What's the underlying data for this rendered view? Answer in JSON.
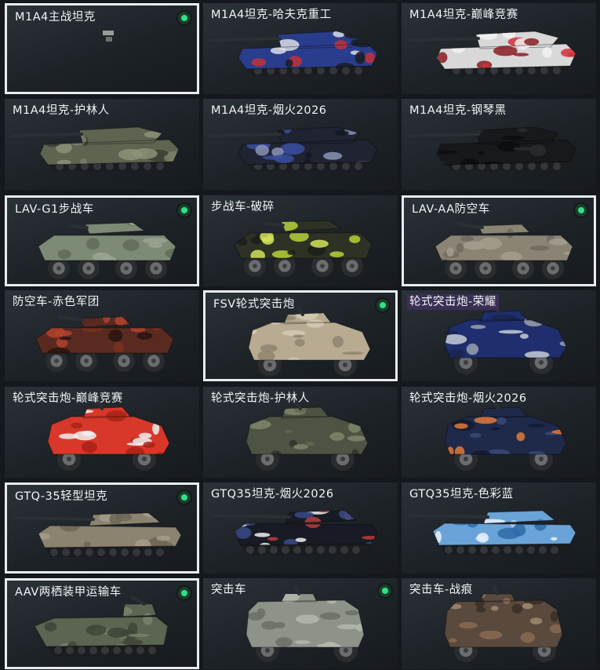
{
  "cards": [
    {
      "name": "M1A4主战坦克",
      "kind": "mbt",
      "hull": "#3a3f37",
      "cam": [],
      "selected": true,
      "equipped": true,
      "empty": true
    },
    {
      "name": "M1A4坦克-哈夫克重工",
      "kind": "mbt",
      "hull": "#2a3d8c",
      "cam": [
        "#d9dde6",
        "#c0323a",
        "#1a1d22"
      ]
    },
    {
      "name": "M1A4坦克-巅峰竞赛",
      "kind": "mbt",
      "hull": "#d8d8d8",
      "cam": [
        "#d3313a",
        "#f2f2f2",
        "#8c1c22"
      ]
    },
    {
      "name": "M1A4坦克-护林人",
      "kind": "mbt",
      "hull": "#5d6450",
      "cam": [
        "#8b9278",
        "#3a4033",
        "#7a7f69"
      ]
    },
    {
      "name": "M1A4坦克-烟火2026",
      "kind": "mbt",
      "hull": "#1f2332",
      "cam": [
        "#3b4fa0",
        "#8a94b5",
        "#141722"
      ]
    },
    {
      "name": "M1A4坦克-钢琴黑",
      "kind": "mbt",
      "hull": "#17191b",
      "cam": [
        "#2a2d30",
        "#0c0d0e"
      ]
    },
    {
      "name": "LAV-G1步战车",
      "kind": "ifv",
      "hull": "#7d8a75",
      "cam": [
        "#9aa592",
        "#5f6b59"
      ],
      "selected": true,
      "equipped": true
    },
    {
      "name": "步战车-破碎",
      "kind": "ifv",
      "hull": "#2d3225",
      "cam": [
        "#b7d13a",
        "#1c1f18",
        "#d4e35a"
      ]
    },
    {
      "name": "LAV-AA防空车",
      "kind": "aa",
      "hull": "#8a8475",
      "cam": [
        "#a39e8e",
        "#6e6a5e"
      ],
      "selected": true,
      "equipped": true
    },
    {
      "name": "防空车-赤色军团",
      "kind": "aa",
      "hull": "#5a2a20",
      "cam": [
        "#b2422e",
        "#2a1410",
        "#7c3020"
      ]
    },
    {
      "name": "FSV轮式突击炮",
      "kind": "fsv",
      "hull": "#b8ab92",
      "cam": [
        "#8f846e",
        "#d4c9b2"
      ],
      "selected": true,
      "equipped": true
    },
    {
      "name": "轮式突击炮-荣耀",
      "kind": "fsv",
      "hull": "#1e2e6e",
      "cam": [
        "#c8ccd6",
        "#9aa0ad",
        "#1a2550"
      ],
      "highlight": true
    },
    {
      "name": "轮式突击炮-巅峰竞赛",
      "kind": "fsv",
      "hull": "#d8382a",
      "cam": [
        "#f0f0f0",
        "#a82218"
      ]
    },
    {
      "name": "轮式突击炮-护林人",
      "kind": "fsv",
      "hull": "#4d5443",
      "cam": [
        "#7f866c",
        "#2f3428",
        "#62694f"
      ]
    },
    {
      "name": "轮式突击炮-烟火2026",
      "kind": "fsv",
      "hull": "#1f2a4a",
      "cam": [
        "#e07a3a",
        "#3a4a7a",
        "#121a30"
      ]
    },
    {
      "name": "GTQ-35轻型坦克",
      "kind": "lt",
      "hull": "#8a8370",
      "cam": [
        "#a59e8a",
        "#6c6656"
      ],
      "selected": true,
      "equipped": true
    },
    {
      "name": "GTQ35坦克-烟火2026",
      "kind": "lt",
      "hull": "#181b24",
      "cam": [
        "#3a4a8a",
        "#c23a3a",
        "#f0f0f0"
      ]
    },
    {
      "name": "GTQ35坦克-色彩蓝",
      "kind": "lt",
      "hull": "#6aa3d8",
      "cam": [
        "#b9d8f2",
        "#2f6aa8",
        "#e8f2fa"
      ]
    },
    {
      "name": "AAV两栖装甲运输车",
      "kind": "aav",
      "hull": "#5c6452",
      "cam": [
        "#7a826c",
        "#3e4436"
      ],
      "selected": true,
      "equipped": true
    },
    {
      "name": "突击车",
      "kind": "mrap",
      "hull": "#8e938a",
      "cam": [
        "#b4b8ae",
        "#6a6f66"
      ],
      "equipped": true
    },
    {
      "name": "突击车-战痕",
      "kind": "mrap",
      "hull": "#5a4a3e",
      "cam": [
        "#8a6a52",
        "#3a2e26",
        "#a08a72"
      ]
    }
  ]
}
